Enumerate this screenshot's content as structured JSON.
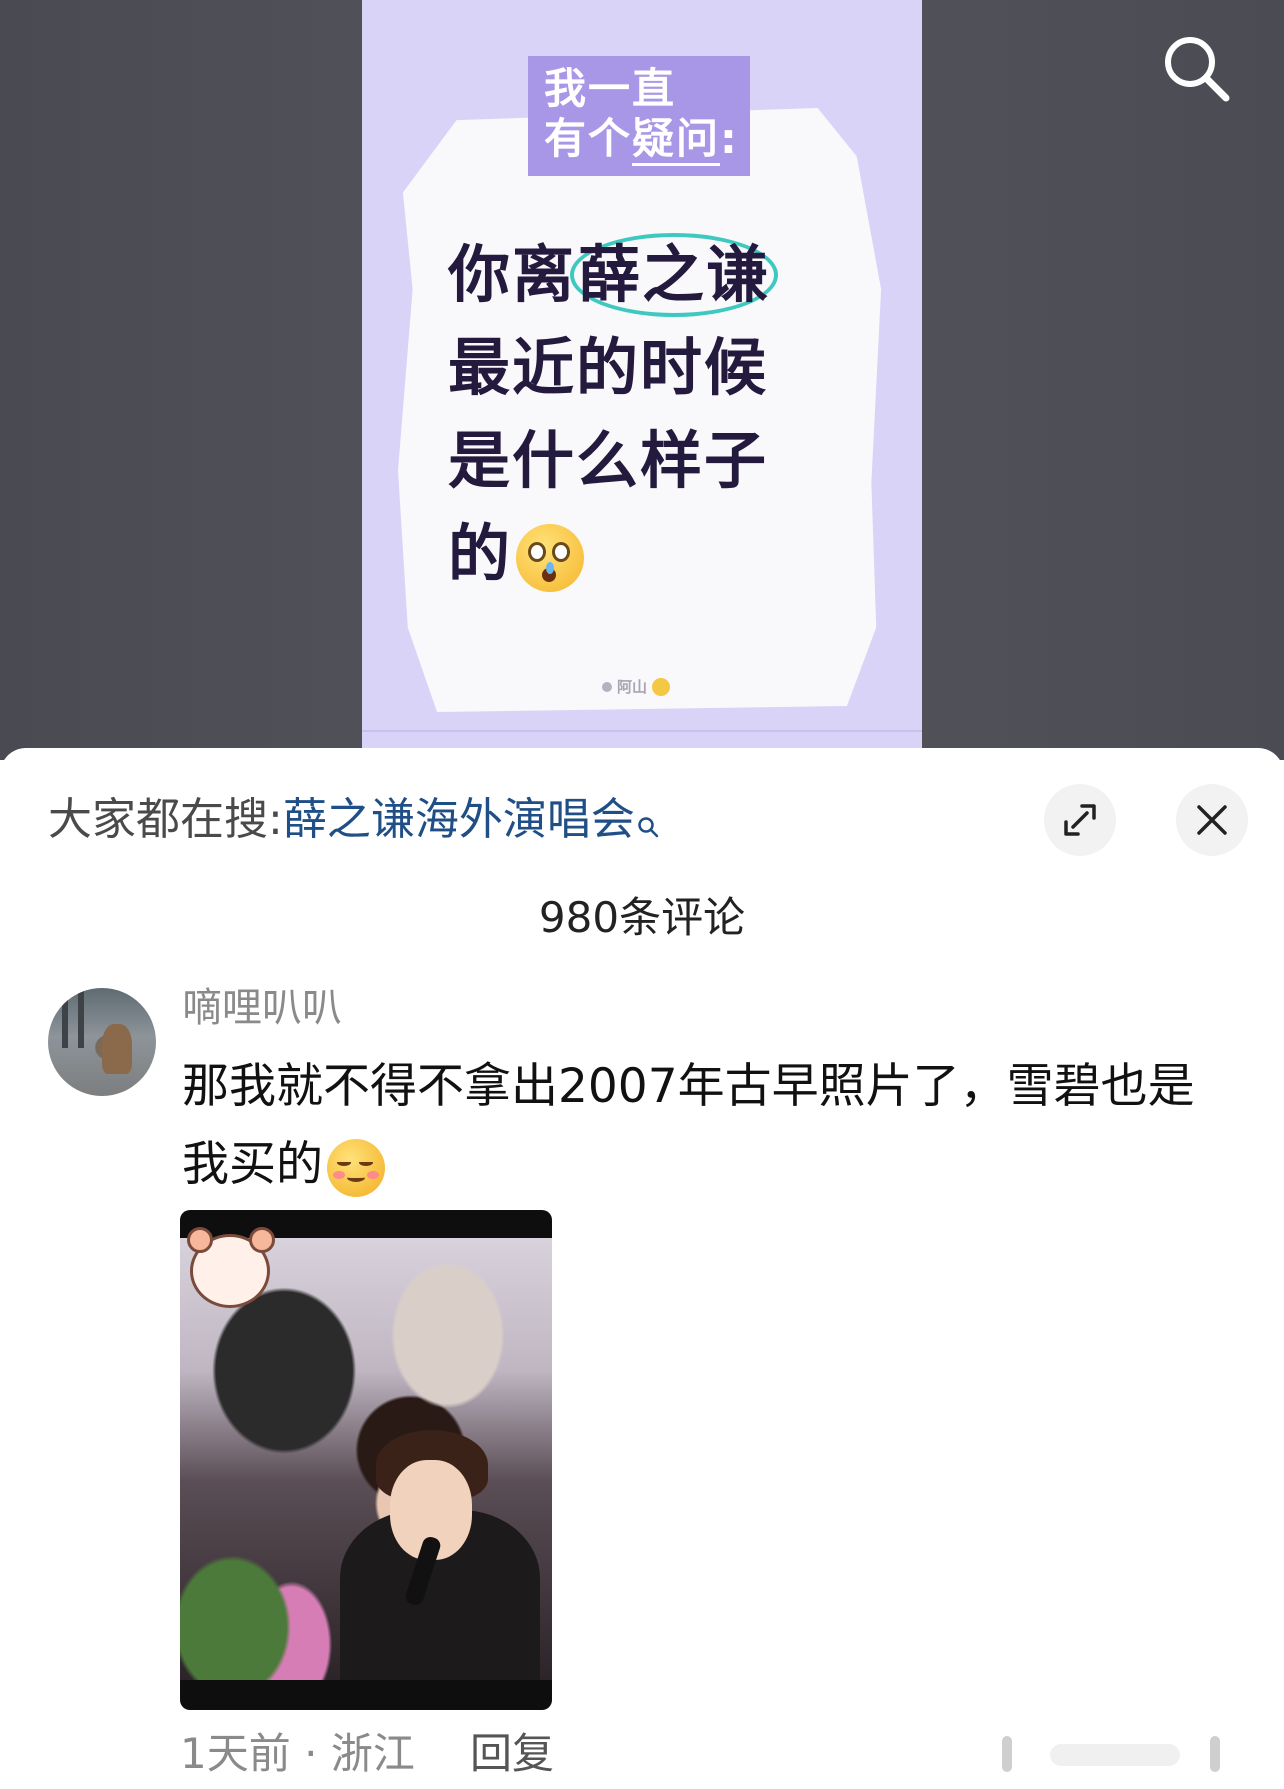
{
  "note": {
    "tag_line1": "我一直",
    "tag_line2_prefix": "有个",
    "tag_line2_underlined": "疑问",
    "tag_line2_suffix": ":",
    "question_line1_prefix": "你离",
    "question_line1_circled": "薛之谦",
    "question_line2": "最近的时候",
    "question_line3": "是什么样子",
    "question_line4": "的",
    "watermark_author": "阿山",
    "accent_color": "#3ec9c0",
    "card_color": "#d9d3f7"
  },
  "top_bar": {
    "search_icon": "search-icon"
  },
  "panel": {
    "hot_search_prefix": "大家都在搜:",
    "hot_search_term": "薛之谦海外演唱会",
    "expand_icon": "expand-icon",
    "close_icon": "close-icon",
    "comment_count": "980条评论"
  },
  "comment": {
    "username": "嘀哩叭叭",
    "text": "那我就不得不拿出2007年古早照片了，雪碧也是我买的",
    "time": "1天前",
    "location": "浙江",
    "meta_separator": "·",
    "reply_label": "回复"
  }
}
